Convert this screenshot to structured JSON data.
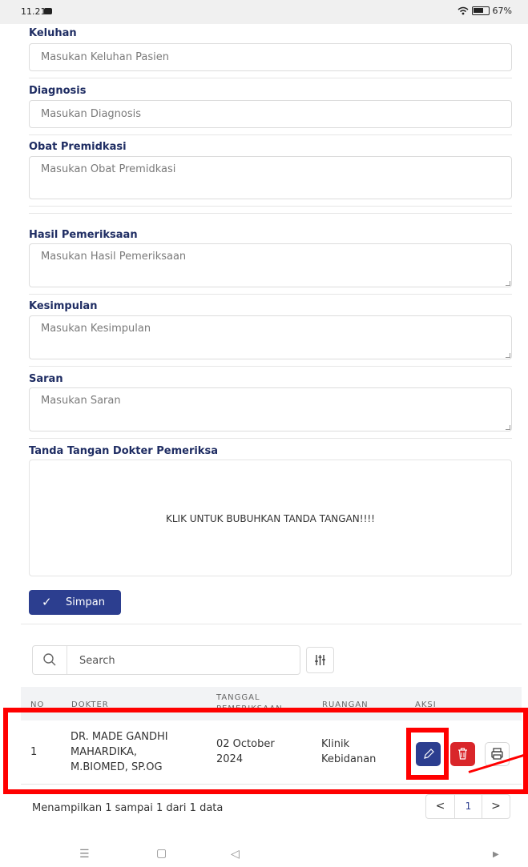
{
  "status_bar": {
    "time": "11.21",
    "battery": "67%"
  },
  "form": {
    "keluhan": {
      "label": "Keluhan",
      "placeholder": "Masukan Keluhan Pasien"
    },
    "diagnosis": {
      "label": "Diagnosis",
      "placeholder": "Masukan Diagnosis"
    },
    "obat": {
      "label": "Obat Premidkasi",
      "placeholder": "Masukan Obat Premidkasi"
    },
    "hasil": {
      "label": "Hasil Pemeriksaan",
      "placeholder": "Masukan Hasil Pemeriksaan"
    },
    "kesimpulan": {
      "label": "Kesimpulan",
      "placeholder": "Masukan Kesimpulan"
    },
    "saran": {
      "label": "Saran",
      "placeholder": "Masukan Saran"
    },
    "signature": {
      "label": "Tanda Tangan Dokter Pemeriksa",
      "prompt": "KLIK UNTUK BUBUHKAN TANDA TANGAN!!!!"
    },
    "save_label": "Simpan"
  },
  "table": {
    "search_placeholder": "Search",
    "headers": {
      "no": "NO",
      "dokter": "DOKTER",
      "tanggal_1": "TANGGAL",
      "tanggal_2": "PEMERIKSAAN",
      "ruangan": "RUANGAN",
      "aksi": "AKSI"
    },
    "rows": [
      {
        "no": "1",
        "dokter_1": "DR. MADE GANDHI",
        "dokter_2": "MAHARDIKA,",
        "dokter_3": "M.BIOMED, SP.OG",
        "tanggal_1": "02 October",
        "tanggal_2": "2024",
        "ruangan_1": "Klinik",
        "ruangan_2": "Kebidanan"
      }
    ],
    "footer": "Menampilkan 1 sampai 1 dari 1 data",
    "pager": {
      "prev": "<",
      "page": "1",
      "next": ">"
    }
  },
  "colors": {
    "primary": "#2c3e8f",
    "danger": "#d9262a",
    "label": "#1f2d63",
    "highlight": "#ff0000"
  },
  "icons": [
    "search-icon",
    "filter-icon",
    "pencil-icon",
    "trash-icon",
    "printer-icon",
    "check-icon",
    "wifi-icon",
    "battery-icon",
    "menu-icon",
    "home-icon",
    "back-icon"
  ]
}
